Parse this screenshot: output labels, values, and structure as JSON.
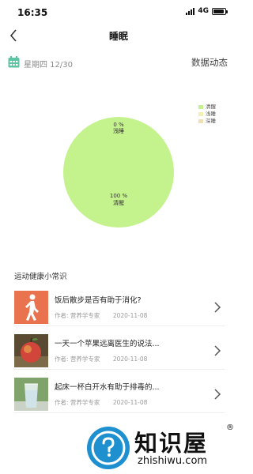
{
  "status_bar": {
    "time": "16:35",
    "network": "4G"
  },
  "nav": {
    "title": "睡眠"
  },
  "date_bar": {
    "date": "星期四 12/30",
    "dynamic_label": "数据动态"
  },
  "chart_data": {
    "type": "pie",
    "series": [
      {
        "name": "清醒",
        "value": 100,
        "label": "100 %",
        "color": "#c4f28c"
      },
      {
        "name": "浅睡",
        "value": 0,
        "label": "0 %",
        "color": "#f2eeb5"
      },
      {
        "name": "深睡",
        "value": 0,
        "label": "0 %",
        "color": "#f0dfb2"
      }
    ],
    "slice_labels": [
      "0 %",
      "浅睡",
      "100 %",
      "清醒"
    ],
    "legend": [
      "清醒",
      "浅睡",
      "深睡"
    ],
    "legend_position": "top-right"
  },
  "section": {
    "title": "运动健康小常识"
  },
  "articles": [
    {
      "title": "饭后散步是否有助于消化?",
      "author": "作者: 营养学专家",
      "date": "2020-11-08",
      "thumb": "walking-person"
    },
    {
      "title": "一天一个苹果远离医生的说法...",
      "author": "作者: 营养学专家",
      "date": "2020-11-08",
      "thumb": "apple"
    },
    {
      "title": "起床一杯白开水有助于排毒的...",
      "author": "作者: 营养学专家",
      "date": "2020-11-08",
      "thumb": "glass-of-water"
    }
  ],
  "watermark": {
    "name": "知识屋",
    "domain": "zhishiwu.com",
    "mark": "®"
  }
}
